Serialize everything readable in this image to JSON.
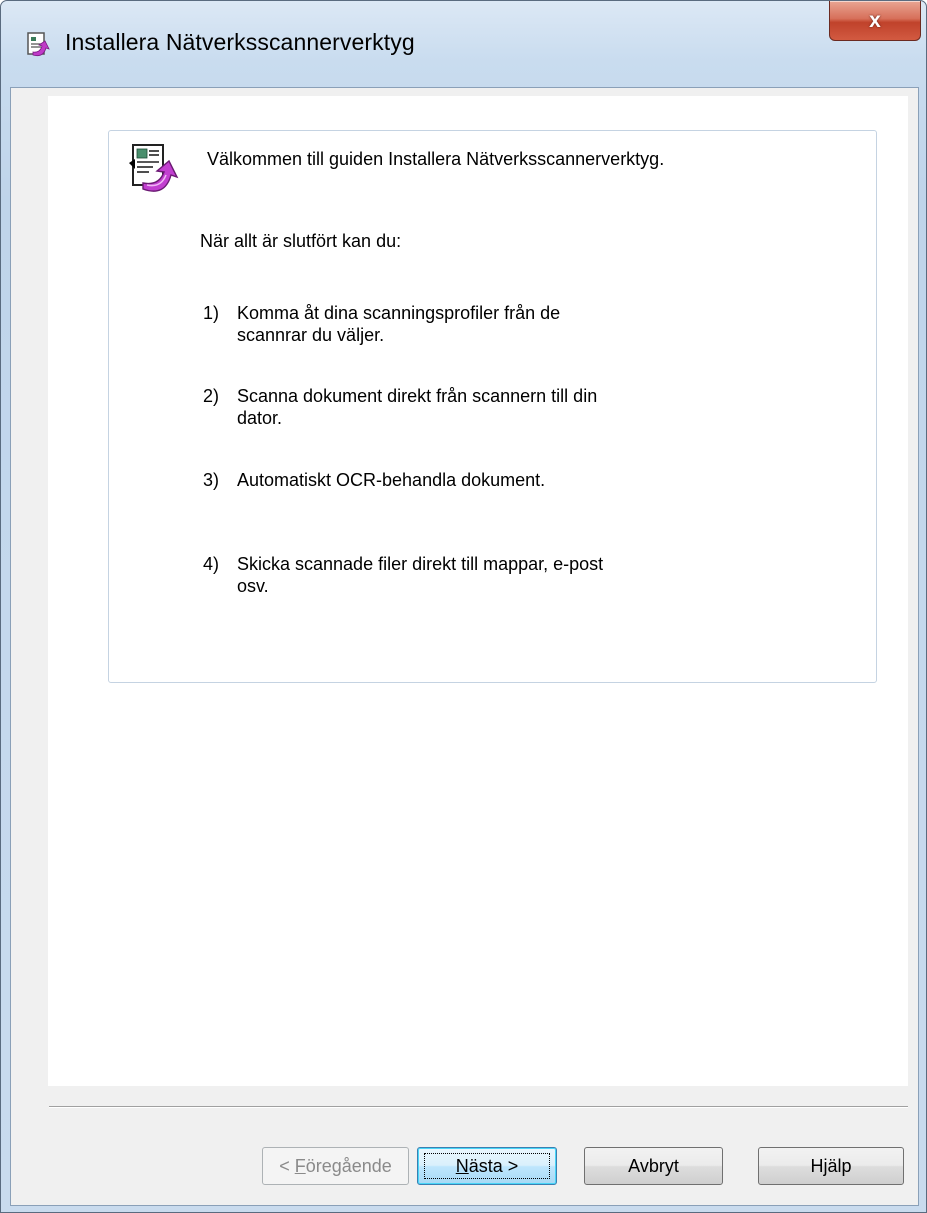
{
  "window": {
    "title": "Installera Nätverksscannerverktyg",
    "close_symbol": "x",
    "icon": "installer-icon"
  },
  "welcome": {
    "icon": "wizard-document-arrow-icon",
    "heading": "Välkommen till guiden Installera Nätverksscannerverktyg.",
    "intro": "När allt är slutfört kan du:",
    "steps": [
      {
        "num": "1)",
        "line1": "Komma åt dina scanningsprofiler från de",
        "line2": "scannrar du väljer."
      },
      {
        "num": "2)",
        "line1": "Scanna dokument direkt från scannern till din",
        "line2": "dator."
      },
      {
        "num": "3)",
        "line1": "Automatiskt OCR-behandla dokument.",
        "line2": ""
      },
      {
        "num": "4)",
        "line1": "Skicka scannade filer direkt till mappar, e-post",
        "line2": "osv."
      }
    ]
  },
  "buttons": {
    "back_prefix": "< ",
    "back_mnemonic": "F",
    "back_rest": "öregående",
    "next_mnemonic": "N",
    "next_rest": "ästa >",
    "cancel": "Avbryt",
    "help": "Hjälp"
  }
}
